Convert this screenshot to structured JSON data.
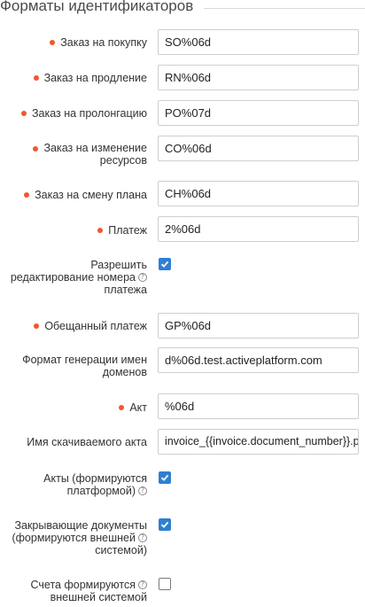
{
  "section": {
    "title": "Форматы идентификаторов"
  },
  "fields": {
    "purchase_order": {
      "label": "Заказ на покупку",
      "value": "SO%06d"
    },
    "renewal_order": {
      "label": "Заказ на продление",
      "value": "RN%06d"
    },
    "prolongation_order": {
      "label": "Заказ на пролонгацию",
      "value": "PO%07d"
    },
    "resource_change_order": {
      "label_line1": "Заказ на изменение",
      "label_line2": "ресурсов",
      "value": "CO%06d"
    },
    "plan_change_order": {
      "label": "Заказ на смену плана",
      "value": "CH%06d"
    },
    "payment": {
      "label": "Платеж",
      "value": "2%06d"
    },
    "allow_edit_payment_number": {
      "label_line1": "Разрешить",
      "label_line2": "редактирование номера",
      "label_line3": "платежа",
      "checked": true
    },
    "promised_payment": {
      "label": "Обещанный платеж",
      "value": "GP%06d"
    },
    "domain_name_format": {
      "label_line1": "Формат генерации имен",
      "label_line2": "доменов",
      "value": "d%06d.test.activeplatform.com"
    },
    "act": {
      "label": "Акт",
      "value": "%06d"
    },
    "downloaded_act_name": {
      "label": "Имя скачиваемого акта",
      "value": "invoice_{{invoice.document_number}}.pdf"
    },
    "acts_generated_by_platform": {
      "label_line1": "Акты (формируются",
      "label_line2": "платформой)",
      "checked": true
    },
    "closing_documents_external": {
      "label_line1": "Закрывающие документы",
      "label_line2": "(формируются внешней",
      "label_line3": "системой)",
      "checked": true
    },
    "invoices_external": {
      "label_line1": "Счета формируются",
      "label_line2": "внешней системой",
      "checked": false
    }
  },
  "colors": {
    "required_dot": "#f0572e",
    "checkbox_accent": "#2f7fd2"
  },
  "icons": {
    "help": "question-circle-icon",
    "check": "check-icon"
  }
}
